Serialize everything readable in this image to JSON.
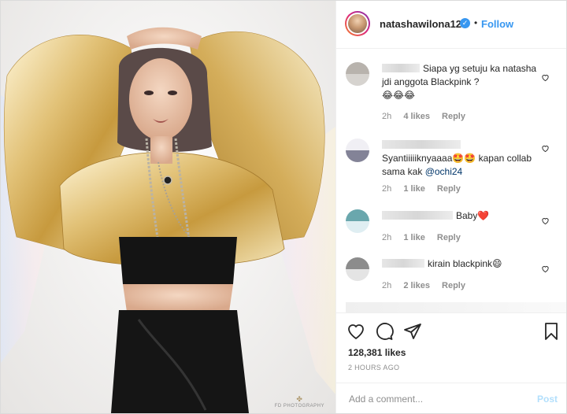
{
  "header": {
    "username": "natashawilona12",
    "verified_icon": "verified-badge-icon",
    "separator": "•",
    "follow_label": "Follow"
  },
  "comments": [
    {
      "text": "Siapa yg setuju ka natasha jdi anggota Blackpink ?",
      "emoji": "😂😂😂",
      "age": "2h",
      "likes": "4 likes",
      "reply": "Reply"
    },
    {
      "text_before": "Syantiiiiiknyaaaa",
      "emoji_mid": "🤩🤩",
      "text_after": " kapan collab sama kak ",
      "mention": "@ochi24",
      "age": "2h",
      "likes": "1 like",
      "reply": "Reply"
    },
    {
      "text": "Baby",
      "emoji": "❤️",
      "age": "2h",
      "likes": "1 like",
      "reply": "Reply"
    },
    {
      "text": "kirain blackpink",
      "emoji": "😄",
      "age": "2h",
      "likes": "2 likes",
      "reply": "Reply"
    }
  ],
  "actions": {
    "icons": [
      "heart-icon",
      "comment-icon",
      "share-icon",
      "bookmark-icon"
    ],
    "likes_count": "128,381 likes",
    "time_ago": "2 HOURS AGO"
  },
  "add_comment": {
    "placeholder": "Add a comment...",
    "post_label": "Post"
  },
  "photo": {
    "watermark": "FD PHOTOGRAPHY"
  },
  "colors": {
    "accent": "#3897f0",
    "text": "#262626",
    "muted": "#8e8e8e",
    "post_disabled": "#b2dffc"
  }
}
